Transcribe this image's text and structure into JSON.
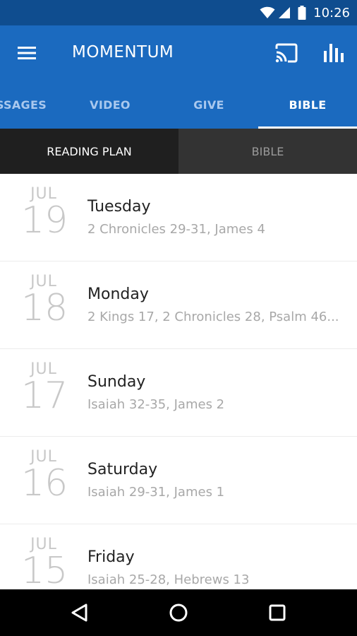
{
  "status_bar": {
    "time": "10:26",
    "icons": [
      "wifi-icon",
      "signal-icon",
      "battery-icon"
    ]
  },
  "app_bar": {
    "title": "MOMENTUM",
    "icons": [
      "menu-icon",
      "cast-icon",
      "stats-icon"
    ]
  },
  "tabs": [
    {
      "label": "SSAGES",
      "active": false
    },
    {
      "label": "VIDEO",
      "active": false
    },
    {
      "label": "GIVE",
      "active": false
    },
    {
      "label": "BIBLE",
      "active": true
    }
  ],
  "subtabs": [
    {
      "label": "READING PLAN",
      "active": true
    },
    {
      "label": "BIBLE",
      "active": false
    }
  ],
  "readings": [
    {
      "month": "JUL",
      "day": "19",
      "weekday": "Tuesday",
      "passages": "2 Chronicles 29-31, James 4"
    },
    {
      "month": "JUL",
      "day": "18",
      "weekday": "Monday",
      "passages": "2 Kings 17, 2 Chronicles 28, Psalm 46..."
    },
    {
      "month": "JUL",
      "day": "17",
      "weekday": "Sunday",
      "passages": "Isaiah 32-35, James 2"
    },
    {
      "month": "JUL",
      "day": "16",
      "weekday": "Saturday",
      "passages": "Isaiah 29-31, James 1"
    },
    {
      "month": "JUL",
      "day": "15",
      "weekday": "Friday",
      "passages": "Isaiah 25-28, Hebrews 13"
    }
  ],
  "nav_bar": {
    "icons": [
      "back-icon",
      "home-icon",
      "recents-icon"
    ]
  },
  "colors": {
    "primary": "#1b6abf",
    "status": "#0f4d8f",
    "subtab_bg": "#333333",
    "subtab_active": "#1f1f1f"
  }
}
